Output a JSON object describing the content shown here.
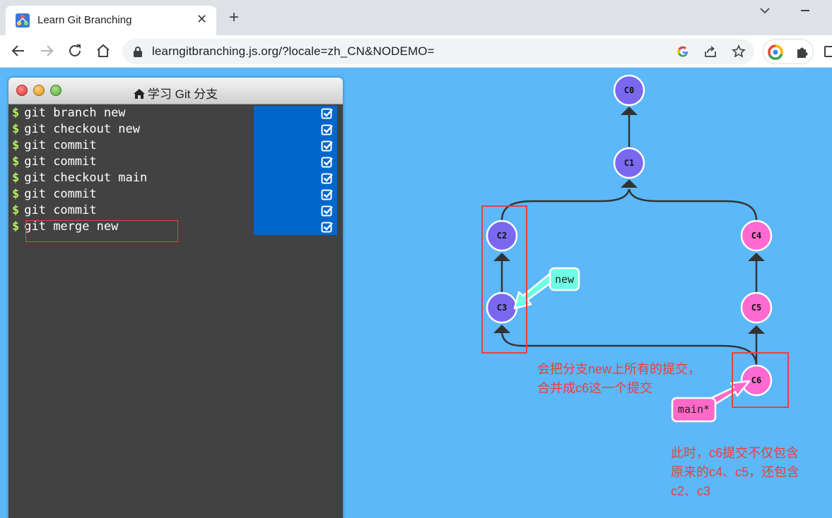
{
  "browser": {
    "tab_title": "Learn Git Branching",
    "url": "learngitbranching.js.org/?locale=zh_CN&NODEMO="
  },
  "terminal": {
    "title": "学习 Git 分支",
    "commands": [
      "git branch new",
      "git checkout new",
      "git commit",
      "git commit",
      "git checkout main",
      "git commit",
      "git commit",
      "git merge new"
    ],
    "prompt": "$"
  },
  "graph": {
    "commits": {
      "c0": "C0",
      "c1": "C1",
      "c2": "C2",
      "c3": "C3",
      "c4": "C4",
      "c5": "C5",
      "c6": "C6"
    },
    "branches": {
      "new": "new",
      "main": "main*"
    },
    "colors": {
      "main_branch": "#ff69c8",
      "new_branch": "#6fffe4",
      "commit_default": "#7b68ee",
      "commit_main": "#ff69d2",
      "annotation": "#f03c3c"
    }
  },
  "annotations": {
    "merge_note": "会把分支new上所有的提交，\n合并成c6这一个提交",
    "c6_note": "此时，c6提交不仅包含\n原来的c4、c5，还包含\nc2、c3"
  }
}
